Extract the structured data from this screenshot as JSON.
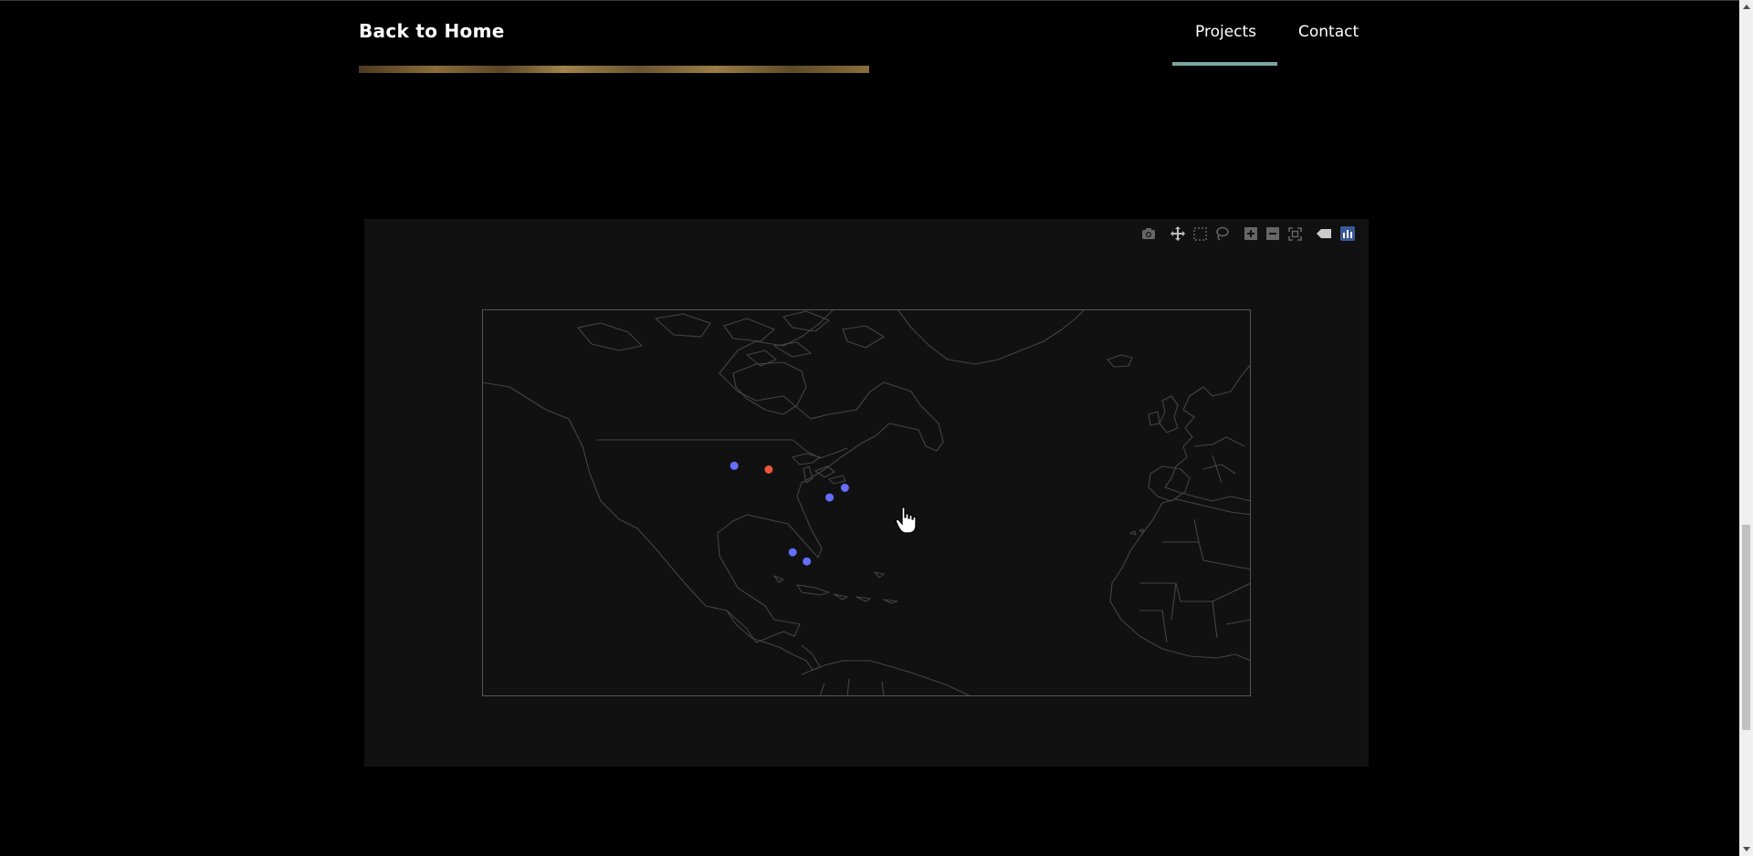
{
  "nav": {
    "home_label": "Back to Home",
    "links": [
      {
        "label": "Projects",
        "active": true
      },
      {
        "label": "Contact",
        "active": false
      }
    ],
    "underline_color": "#7aa8a0"
  },
  "plot": {
    "background": "#111111",
    "modebar": {
      "icons": [
        "camera-icon",
        "pan-icon",
        "box-select-icon",
        "lasso-icon",
        "zoom-in-icon",
        "zoom-out-icon",
        "autoscale-icon",
        "hover-label-icon",
        "plotly-logo-icon"
      ]
    },
    "map": {
      "projection": "equirectangular",
      "lon_range": [
        -134,
        -9
      ],
      "lat_range": [
        2,
        74
      ],
      "coastline_color": "#444444",
      "frame_color": "#555555",
      "markers": [
        {
          "lon": -93.0,
          "lat": 44.9,
          "color": "#636efa"
        },
        {
          "lon": -87.4,
          "lat": 44.2,
          "color": "#ef553b"
        },
        {
          "lon": -77.5,
          "lat": 39.0,
          "color": "#636efa"
        },
        {
          "lon": -75.0,
          "lat": 40.8,
          "color": "#636efa"
        },
        {
          "lon": -83.5,
          "lat": 28.8,
          "color": "#636efa"
        },
        {
          "lon": -81.2,
          "lat": 27.1,
          "color": "#636efa"
        }
      ]
    }
  }
}
